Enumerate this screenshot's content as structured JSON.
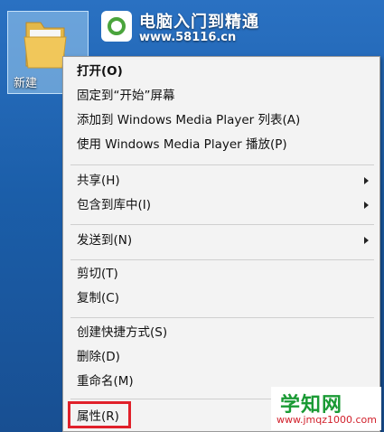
{
  "desktop": {
    "folder_label": "新建"
  },
  "logo": {
    "title": "电脑入门到精通",
    "url": "www.58116.cn"
  },
  "context_menu": {
    "items": [
      {
        "label": "打开(O)",
        "bold": true
      },
      {
        "label": "固定到“开始”屏幕"
      },
      {
        "label": "添加到 Windows Media Player 列表(A)"
      },
      {
        "label": "使用 Windows Media Player 播放(P)"
      },
      {
        "label": "共享(H)",
        "submenu": true
      },
      {
        "label": "包含到库中(I)",
        "submenu": true
      },
      {
        "label": "发送到(N)",
        "submenu": true
      },
      {
        "label": "剪切(T)"
      },
      {
        "label": "复制(C)"
      },
      {
        "label": "创建快捷方式(S)"
      },
      {
        "label": "删除(D)"
      },
      {
        "label": "重命名(M)"
      },
      {
        "label": "属性(R)",
        "highlighted": true
      }
    ]
  },
  "watermark": {
    "title": "学知网",
    "url": "www.jmqz1000.com"
  },
  "colors": {
    "highlight_border": "#e0202a",
    "menu_background": "#f3f3f3"
  }
}
